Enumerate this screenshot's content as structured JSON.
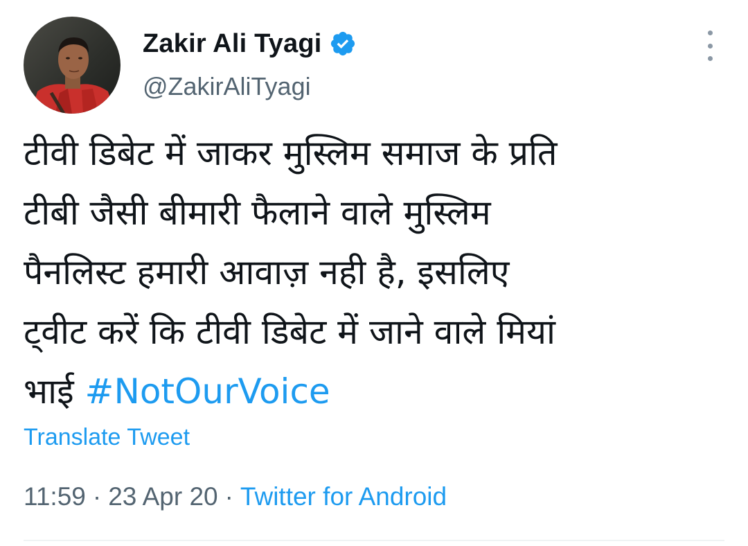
{
  "tweet": {
    "author": {
      "display_name": "Zakir Ali Tyagi",
      "handle": "@ZakirAliTyagi",
      "verified": true,
      "avatar_icon": "profile-photo"
    },
    "text_lines": [
      "टीवी डिबेट में जाकर मुस्लिम समाज के प्रति",
      "टीबी जैसी बीमारी फैलाने वाले मुस्लिम",
      "पैनलिस्ट हमारी आवाज़ नही है, इसलिए",
      "ट्वीट करें कि टीवी डिबेट में जाने वाले मियां"
    ],
    "last_line_prefix": "भाई ",
    "hashtag": "#NotOurVoice",
    "translate_label": "Translate Tweet",
    "time": "11:59",
    "separator": "·",
    "date": "23 Apr 20",
    "source": "Twitter for Android",
    "colors": {
      "link": "#1d9bf0",
      "secondary_text": "#536471",
      "primary_text": "#0f1419",
      "verified_badge": "#1d9bf0"
    },
    "icons": {
      "verified": "verified-badge-icon",
      "more": "more-vertical-icon"
    }
  }
}
